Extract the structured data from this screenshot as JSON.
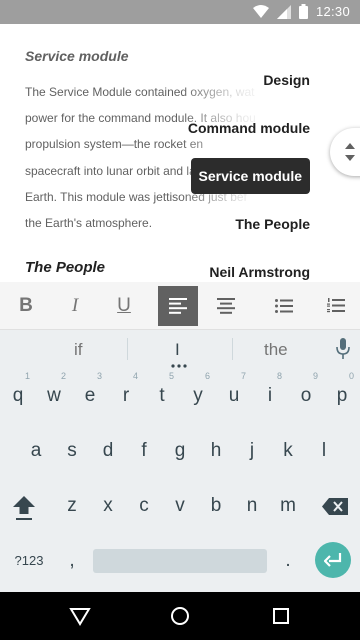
{
  "status": {
    "time": "12:30"
  },
  "document": {
    "heading": "Service module",
    "paragraph_lines": [
      "The Service Module contained oxygen, wat",
      "power for the command module. It also hou",
      "propulsion system—the rocket en",
      "spacecraft into lunar orbit and late",
      "Earth. This module was jettisoned just bef",
      "the Earth's atmosphere."
    ],
    "heading2": "The People"
  },
  "outline": {
    "items": [
      {
        "label": "Design"
      },
      {
        "label": "Command module"
      },
      {
        "label": "Service module",
        "active": true
      },
      {
        "label": "The People"
      },
      {
        "label": "Neil Armstrong"
      }
    ]
  },
  "toolbar": {
    "bold": "B",
    "italic": "I",
    "underline": "U",
    "active_align": "align-left"
  },
  "suggestions": [
    "if",
    "I",
    "the"
  ],
  "keyboard": {
    "row1": [
      "q",
      "w",
      "e",
      "r",
      "t",
      "y",
      "u",
      "i",
      "o",
      "p"
    ],
    "row1_numbers": [
      "1",
      "2",
      "3",
      "4",
      "5",
      "6",
      "7",
      "8",
      "9",
      "0"
    ],
    "row2": [
      "a",
      "s",
      "d",
      "f",
      "g",
      "h",
      "j",
      "k",
      "l"
    ],
    "row3": [
      "z",
      "x",
      "c",
      "v",
      "b",
      "n",
      "m"
    ],
    "symbols_key": "?123",
    "comma": ",",
    "period": "."
  },
  "colors": {
    "accent_enter": "#4db6ac",
    "status_bar": "#9e9e9e",
    "keyboard_bg": "#eceff1",
    "active_tool": "#616161"
  },
  "icons": {
    "status": [
      "wifi-icon",
      "signal-icon",
      "battery-icon"
    ],
    "nav": [
      "back-icon",
      "home-icon",
      "recents-icon"
    ]
  }
}
